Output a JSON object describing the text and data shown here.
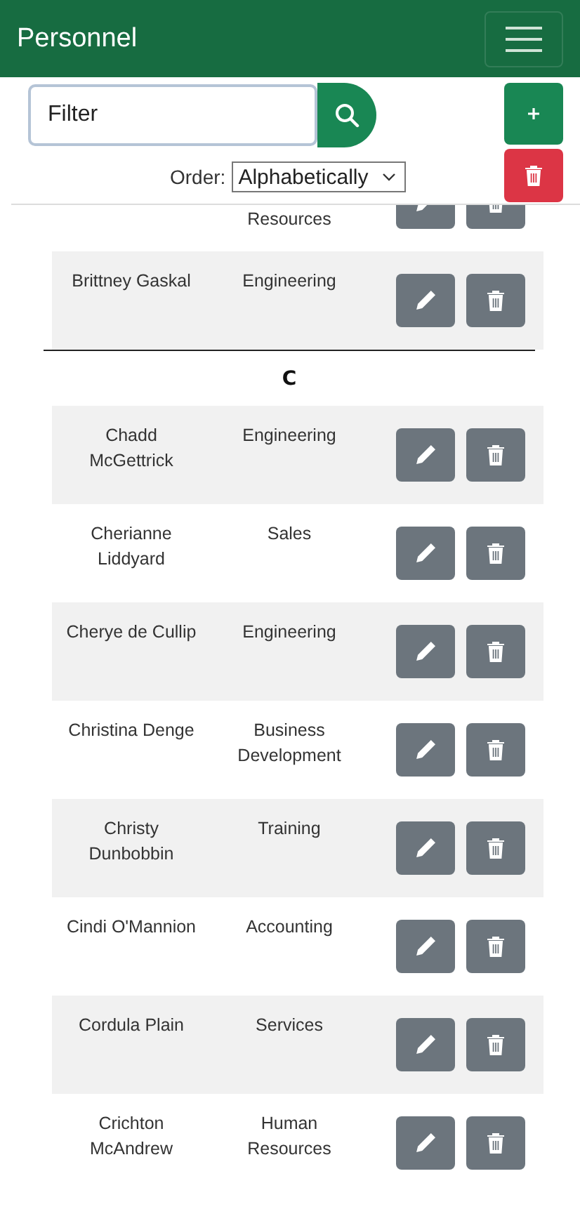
{
  "header": {
    "title": "Personnel"
  },
  "filter": {
    "placeholder": "Filter"
  },
  "order": {
    "label": "Order:",
    "value": "Alphabetically"
  },
  "sections": [
    {
      "rows": [
        {
          "name": "",
          "department": "Resources"
        },
        {
          "name": "Brittney Gaskal",
          "department": "Engineering"
        }
      ]
    },
    {
      "heading": "C",
      "rows": [
        {
          "name": "Chadd McGettrick",
          "department": "Engineering"
        },
        {
          "name": "Cherianne Liddyard",
          "department": "Sales"
        },
        {
          "name": "Cherye de Cullip",
          "department": "Engineering"
        },
        {
          "name": "Christina Denge",
          "department": "Business Development"
        },
        {
          "name": "Christy Dunbobbin",
          "department": "Training"
        },
        {
          "name": "Cindi O'Mannion",
          "department": "Accounting"
        },
        {
          "name": "Cordula Plain",
          "department": "Services"
        },
        {
          "name": "Crichton McAndrew",
          "department": "Human Resources"
        }
      ]
    }
  ]
}
